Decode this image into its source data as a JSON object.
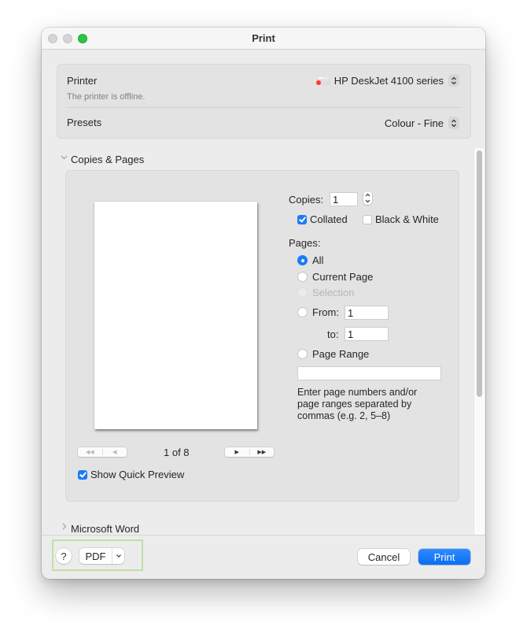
{
  "window": {
    "title": "Print",
    "traffic_lights": [
      "close-inactive",
      "minimize-inactive",
      "zoom"
    ]
  },
  "printer_section": {
    "printer_label": "Printer",
    "printer_value": "HP DeskJet 4100 series",
    "printer_status": "The printer is offline.",
    "status_color": "#ff3b30",
    "presets_label": "Presets",
    "presets_value": "Colour - Fine"
  },
  "copies_pages": {
    "section_title": "Copies & Pages",
    "copies_label": "Copies:",
    "copies_value": "1",
    "collated_label": "Collated",
    "collated_checked": true,
    "black_white_label": "Black & White",
    "black_white_checked": false,
    "pages_label": "Pages:",
    "page_options": [
      {
        "label": "All",
        "selected": true,
        "enabled": true
      },
      {
        "label": "Current Page",
        "selected": false,
        "enabled": true
      },
      {
        "label": "Selection",
        "selected": false,
        "enabled": false
      },
      {
        "label": "From:",
        "selected": false,
        "enabled": true
      },
      {
        "label": "Page Range",
        "selected": false,
        "enabled": true
      }
    ],
    "from_value": "1",
    "to_label": "to:",
    "to_value": "1",
    "page_range_value": "",
    "help_text": "Enter page numbers and/or page ranges separated by commas (e.g. 2, 5-8)",
    "help_lines": [
      "Enter page numbers and/or",
      "page ranges separated by",
      "commas (e.g. 2, 5–8)"
    ]
  },
  "preview": {
    "page_indicator": "1 of 8",
    "current_page": 1,
    "total_pages": 8,
    "nav_first": "◀◀",
    "nav_prev": "◀",
    "nav_next": "▶",
    "nav_last": "▶▶",
    "quick_preview_label": "Show Quick Preview",
    "quick_preview_checked": true
  },
  "collapsed_section": {
    "title": "Microsoft Word"
  },
  "footer": {
    "help_label": "?",
    "pdf_label": "PDF",
    "pdf_menu_icon": "⌄",
    "cancel_label": "Cancel",
    "print_label": "Print"
  },
  "colors": {
    "accent": "#1b7cf5",
    "highlight": "#bfe0a8"
  }
}
